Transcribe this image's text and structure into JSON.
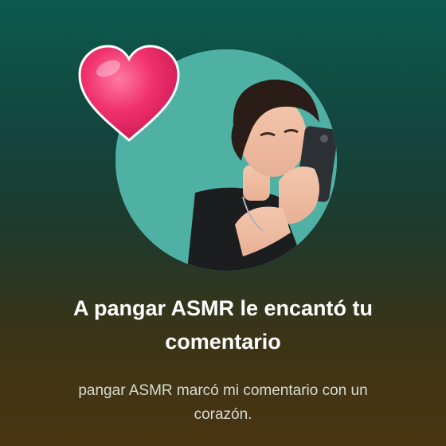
{
  "notification": {
    "title": "A pangar ASMR le encantó tu comentario",
    "subtitle": "pangar ASMR marcó mi comentario con un corazón."
  },
  "icons": {
    "reaction": "heart-icon",
    "profile": "avatar"
  },
  "colors": {
    "background_top": "#0c5a4e",
    "background_bottom": "#4a3410",
    "avatar_background": "#4fb1a3",
    "heart": "#f0326e",
    "title_text": "#ffffff",
    "subtitle_text": "#d6dcd4"
  }
}
